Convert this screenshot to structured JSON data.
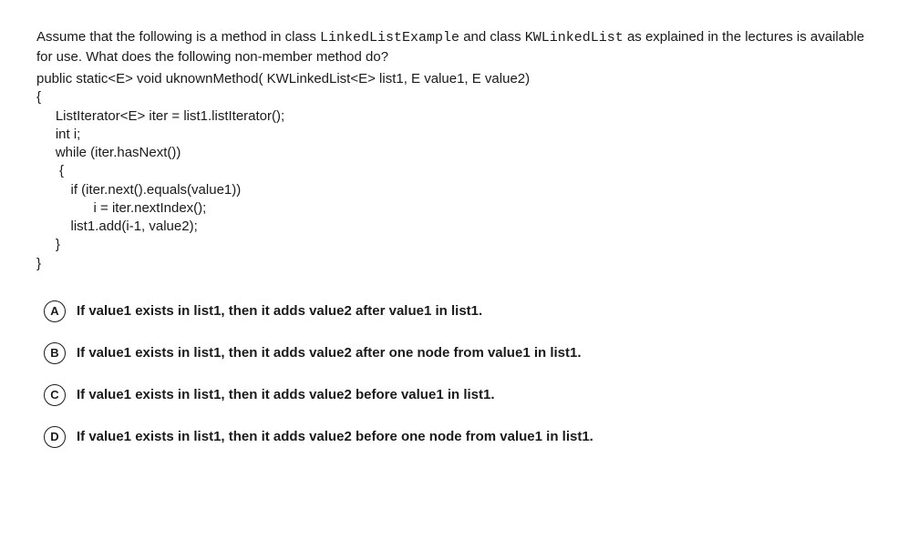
{
  "question": {
    "intro_pre": "Assume that the following is a method in class ",
    "class1": "LinkedListExample",
    "intro_mid1": " and class ",
    "class2": "KWLinkedList",
    "intro_mid2": " as explained in the lectures is available for use. What does the following non-member method do?",
    "code": "public static<E> void uknownMethod( KWLinkedList<E> list1, E value1, E value2)\n{\n     ListIterator<E> iter = list1.listIterator();\n     int i;\n     while (iter.hasNext())\n      {\n         if (iter.next().equals(value1))\n               i = iter.nextIndex();\n         list1.add(i-1, value2);\n     }\n}"
  },
  "options": [
    {
      "letter": "A",
      "text": "If value1 exists in list1, then it adds value2 after value1 in list1."
    },
    {
      "letter": "B",
      "text": "If value1 exists in list1, then it adds value2 after one node from value1 in list1."
    },
    {
      "letter": "C",
      "text": "If value1 exists in list1, then it adds value2 before value1 in list1."
    },
    {
      "letter": "D",
      "text": "If value1 exists in list1, then it adds value2 before one node from value1 in list1."
    }
  ]
}
